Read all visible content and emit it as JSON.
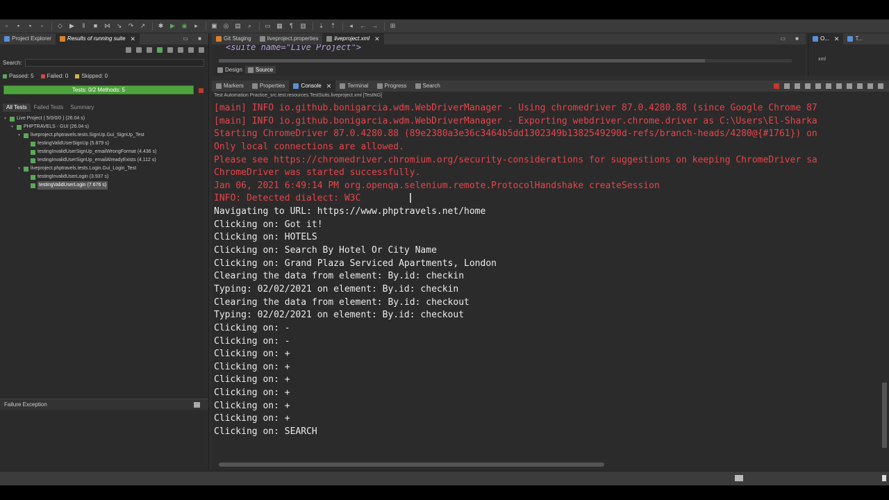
{
  "left_panel": {
    "tabs": [
      {
        "label": "Project Explorer"
      },
      {
        "label": "Results of running suite"
      }
    ],
    "search_label": "Search:",
    "stats": {
      "passed": "Passed: 5",
      "failed": "Failed: 0",
      "skipped": "Skipped: 0"
    },
    "progress_label": "Tests: 0/2  Methods: 5",
    "progress_fraction": 1.0,
    "subtabs": [
      "All Tests",
      "Failed Tests",
      "Summary"
    ],
    "tree": [
      {
        "label": "Live Project ( 5/0/0/0 ) (26.04 s)"
      },
      {
        "label": "PHPTRAVELS - GUI (26.04 s)"
      },
      {
        "label": "liveproject.phptravels.tests.SignUp.Gui_SignUp_Test"
      },
      {
        "label": "testingValidUserSignUp (5.879 s)"
      },
      {
        "label": "testingInvalidUserSignUp_emailWrongFormat (4.436 s)"
      },
      {
        "label": "testingInvalidUserSignUp_emailAlreadyExists (4.112 s)"
      },
      {
        "label": "liveproject.phptravels.tests.Login.Gui_Login_Test"
      },
      {
        "label": "testingInvalidUserLogin (3.937 s)"
      },
      {
        "label": "testingValidUserLogin (7.676 s)"
      }
    ],
    "failure_label": "Failure Exception"
  },
  "editor": {
    "tabs": [
      {
        "label": "Git Staging"
      },
      {
        "label": "liveproject.properties"
      },
      {
        "label": "liveproject.xml"
      }
    ],
    "code_snippet": "<suite name=\"Live Project\">",
    "design_tab": "Design",
    "source_tab": "Source"
  },
  "outline": {
    "tab": "O...",
    "tab2": "T...",
    "item": "xml"
  },
  "console": {
    "tabs": [
      {
        "label": "Markers"
      },
      {
        "label": "Properties"
      },
      {
        "label": "Console"
      },
      {
        "label": "Terminal"
      },
      {
        "label": "Progress"
      },
      {
        "label": "Search"
      }
    ],
    "path": "Test Automation Practice_src.test.resources.TestSuits.liveproject.xml [TestNG]",
    "lines": [
      {
        "type": "err",
        "text": "[main] INFO io.github.bonigarcia.wdm.WebDriverManager - Using chromedriver 87.0.4280.88 (since Google Chrome 87"
      },
      {
        "type": "err",
        "text": "[main] INFO io.github.bonigarcia.wdm.WebDriverManager - Exporting webdriver.chrome.driver as C:\\Users\\El-Sharka"
      },
      {
        "type": "err",
        "text": "Starting ChromeDriver 87.0.4280.88 (89e2380a3e36c3464b5dd1302349b1382549290d-refs/branch-heads/4280@{#1761}) on"
      },
      {
        "type": "err",
        "text": "Only local connections are allowed."
      },
      {
        "type": "err",
        "text": "Please see https://chromedriver.chromium.org/security-considerations for suggestions on keeping ChromeDriver sa"
      },
      {
        "type": "err",
        "text": "ChromeDriver was started successfully."
      },
      {
        "type": "err",
        "text": "Jan 06, 2021 6:49:14 PM org.openqa.selenium.remote.ProtocolHandshake createSession"
      },
      {
        "type": "err",
        "text": "INFO: Detected dialect: W3C"
      },
      {
        "type": "out",
        "text": "Navigating to URL: https://www.phptravels.net/home"
      },
      {
        "type": "out",
        "text": "Clicking on: Got it!"
      },
      {
        "type": "out",
        "text": "Clicking on: HOTELS"
      },
      {
        "type": "out",
        "text": "Clicking on: Search By Hotel Or City Name"
      },
      {
        "type": "out",
        "text": "Clicking on: Grand Plaza Serviced Apartments, London"
      },
      {
        "type": "out",
        "text": "Clearing the data from element: By.id: checkin"
      },
      {
        "type": "out",
        "text": "Typing: 02/02/2021 on element: By.id: checkin"
      },
      {
        "type": "out",
        "text": "Clearing the data from element: By.id: checkout"
      },
      {
        "type": "out",
        "text": "Typing: 02/02/2021 on element: By.id: checkout"
      },
      {
        "type": "out",
        "text": "Clicking on: -"
      },
      {
        "type": "out",
        "text": "Clicking on: -"
      },
      {
        "type": "out",
        "text": "Clicking on: +"
      },
      {
        "type": "out",
        "text": "Clicking on: +"
      },
      {
        "type": "out",
        "text": "Clicking on: +"
      },
      {
        "type": "out",
        "text": "Clicking on: +"
      },
      {
        "type": "out",
        "text": "Clicking on: +"
      },
      {
        "type": "out",
        "text": "Clicking on: +"
      },
      {
        "type": "out",
        "text": "Clicking on: SEARCH"
      }
    ]
  },
  "colors": {
    "error_text": "#e8444a",
    "output_text": "#ececec",
    "progress_green": "#4fa33e"
  }
}
